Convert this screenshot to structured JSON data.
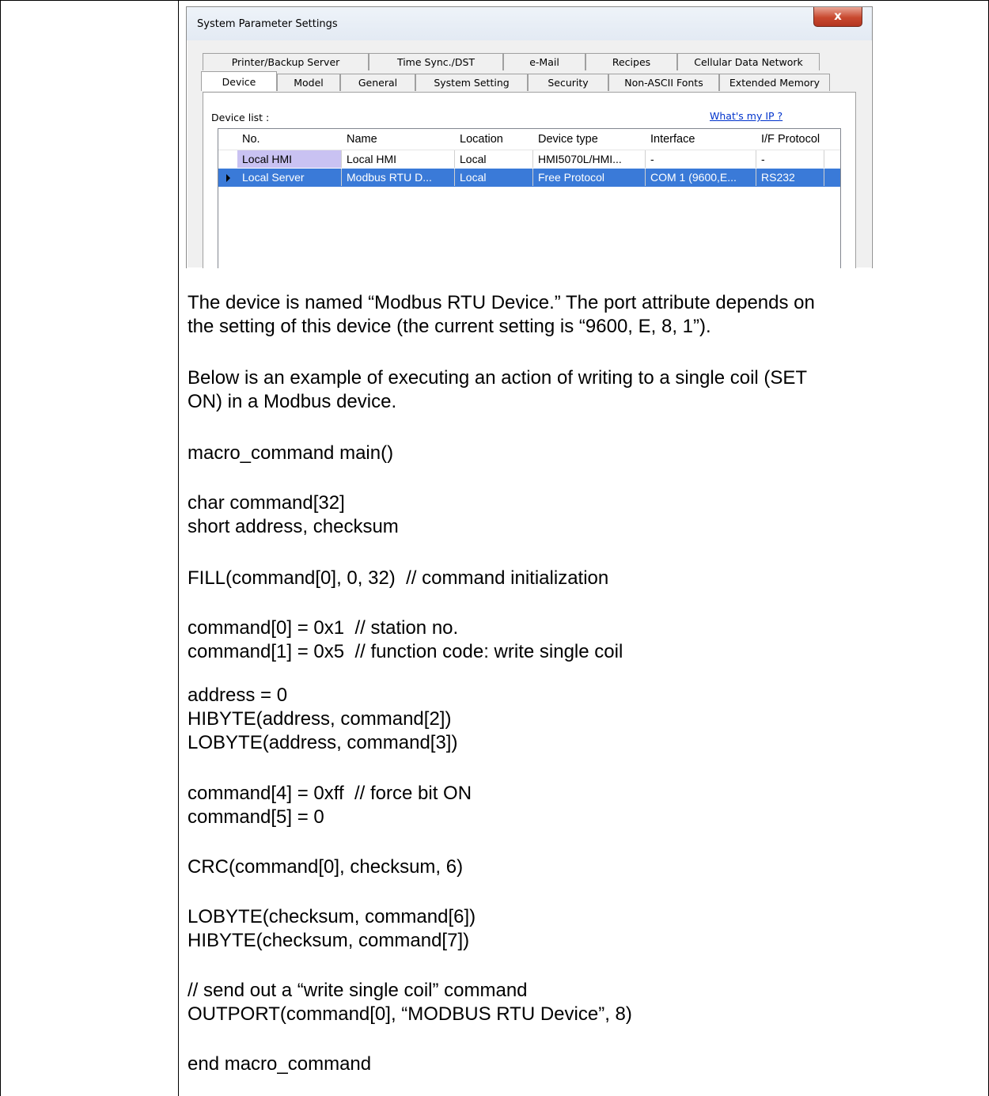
{
  "dialog": {
    "title": "System Parameter Settings",
    "close_label": "x",
    "tabs_back": [
      "Printer/Backup Server",
      "Time Sync./DST",
      "e-Mail",
      "Recipes",
      "Cellular Data Network"
    ],
    "tabs_front": [
      "Device",
      "Model",
      "General",
      "System Setting",
      "Security",
      "Non-ASCII Fonts",
      "Extended Memory"
    ],
    "active_tab": "Device",
    "device_list_label": "Device list :",
    "whats_my_ip": "What's my IP ?",
    "columns": [
      "No.",
      "Name",
      "Location",
      "Device type",
      "Interface",
      "I/F Protocol"
    ],
    "rows": [
      [
        "Local HMI",
        "Local HMI",
        "Local",
        "HMI5070L/HMI...",
        "-",
        "-"
      ],
      [
        "Local Server",
        "Modbus RTU D...",
        "Local",
        "Free Protocol",
        "COM 1 (9600,E...",
        "RS232"
      ]
    ],
    "selected_row": 1
  },
  "content": {
    "p1_l1": "The device is named “Modbus RTU Device.” The port attribute depends on",
    "p1_l2": "the setting of this device (the current setting is “9600, E, 8, 1”).",
    "p2_l1": "Below is an example of executing an action of writing to a single coil (SET",
    "p2_l2": "ON) in a Modbus device.",
    "c1": "macro_command main()",
    "c2": "char command[32]",
    "c3": "short address, checksum",
    "c4": "FILL(command[0], 0, 32)  // command initialization",
    "c5": "command[0] = 0x1  // station no.",
    "c6": "command[1] = 0x5  // function code: write single coil",
    "c7": "address = 0",
    "c8": "HIBYTE(address, command[2])",
    "c9": "LOBYTE(address, command[3])",
    "c10": "command[4] = 0xff  // force bit ON",
    "c11": "command[5] = 0",
    "c12": "CRC(command[0], checksum, 6)",
    "c13": "LOBYTE(checksum, command[6])",
    "c14": "HIBYTE(checksum, command[7])",
    "c15": "// send out a “write single coil” command",
    "c16": "OUTPORT(command[0], “MODBUS RTU Device”, 8)",
    "c17": "end macro_command"
  }
}
